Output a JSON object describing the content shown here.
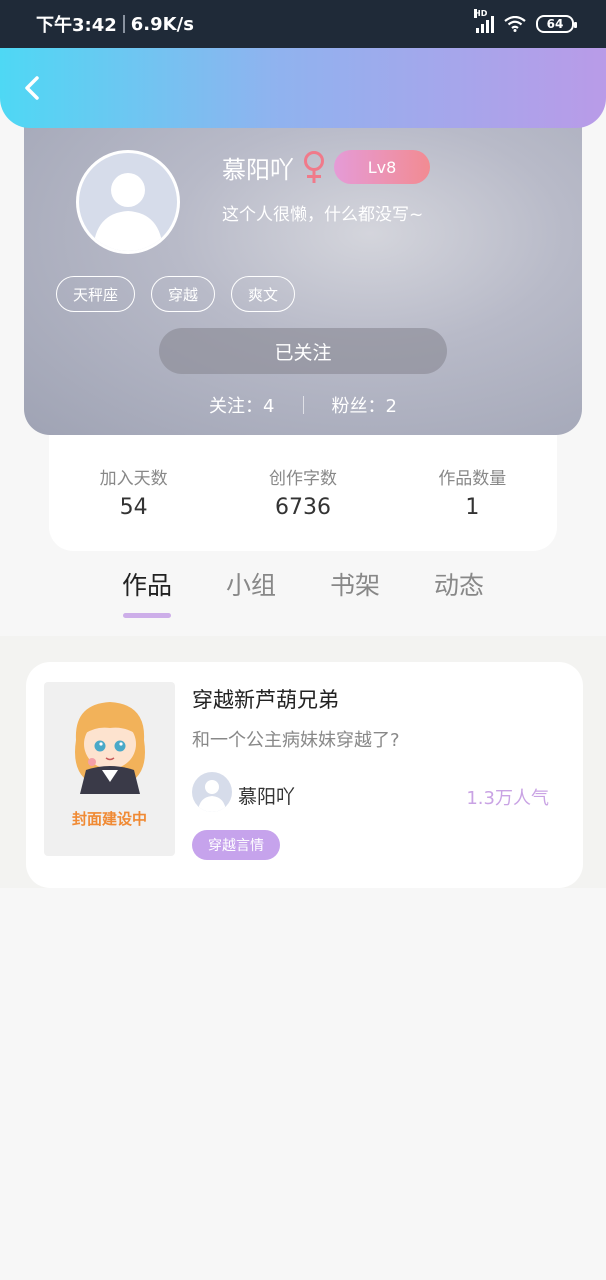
{
  "status_bar": {
    "time": "下午3:42",
    "speed": "6.9K/s",
    "battery": "64"
  },
  "profile": {
    "username": "慕阳吖",
    "level": "Lv8",
    "bio": "这个人很懒，什么都没写~",
    "tags": [
      "天秤座",
      "穿越",
      "爽文"
    ],
    "follow_button": "已关注",
    "following_label": "关注：4",
    "followers_label": "粉丝：2"
  },
  "stats": [
    {
      "label": "加入天数",
      "value": "54"
    },
    {
      "label": "创作字数",
      "value": "6736"
    },
    {
      "label": "作品数量",
      "value": "1"
    }
  ],
  "tabs": [
    {
      "label": "作品",
      "active": true
    },
    {
      "label": "小组",
      "active": false
    },
    {
      "label": "书架",
      "active": false
    },
    {
      "label": "动态",
      "active": false
    }
  ],
  "book": {
    "title": "穿越新芦葫兄弟",
    "description": "和一个公主病妹妹穿越了?",
    "author": "慕阳吖",
    "popularity": "1.3万人气",
    "genre": "穿越言情",
    "cover_text": "封面建设中"
  },
  "colors": {
    "header_gradient_start": "#4ed8f4",
    "header_gradient_end": "#b99be8",
    "accent_purple": "#c6a3ec",
    "level_badge": "#f28b92",
    "female_icon": "#f07a8a"
  }
}
